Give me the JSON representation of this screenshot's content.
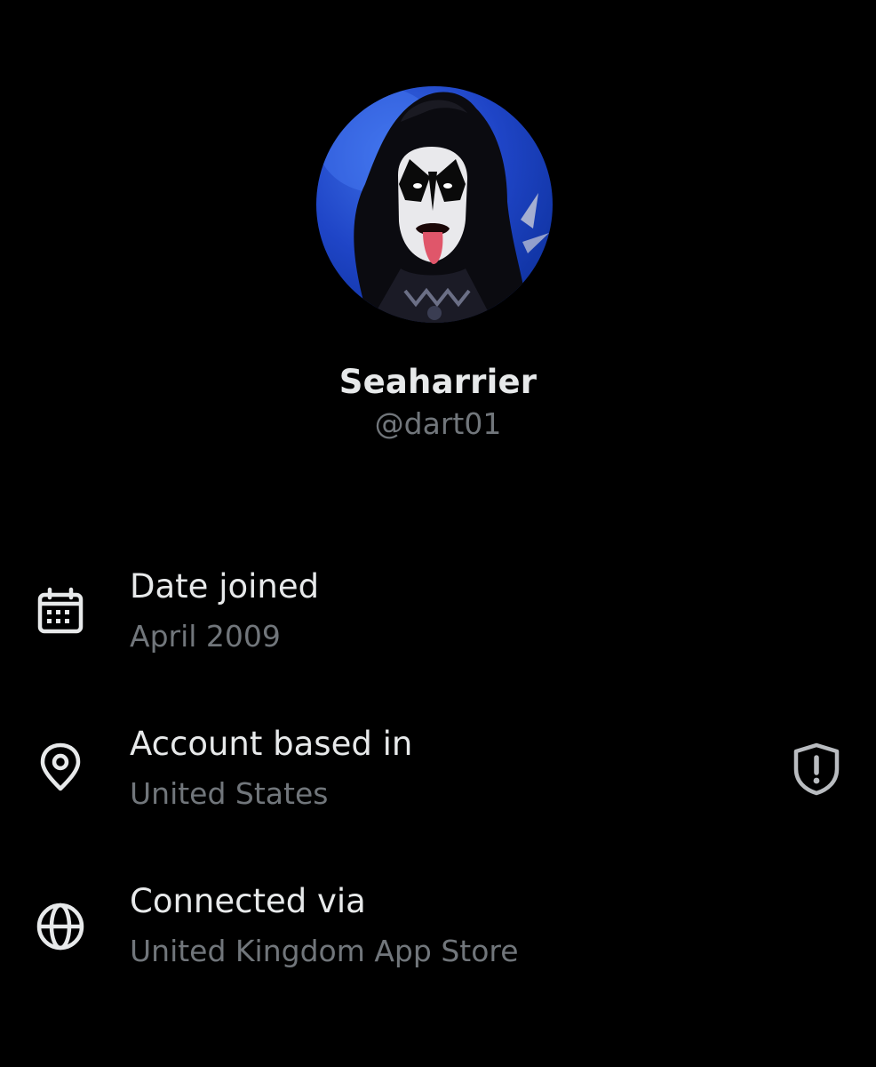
{
  "profile": {
    "display_name": "Seaharrier",
    "handle": "@dart01"
  },
  "about": {
    "items": [
      {
        "title": "Date joined",
        "value": "April 2009",
        "icon": "calendar-icon"
      },
      {
        "title": "Account based in",
        "value": "United States",
        "icon": "location-pin-icon",
        "badge_icon": "shield-alert-icon"
      },
      {
        "title": "Connected via",
        "value": "United Kingdom App Store",
        "icon": "globe-icon"
      }
    ]
  },
  "colors": {
    "background": "#000000",
    "primary_text": "#e7e9ea",
    "secondary_text": "#71767b",
    "avatar_background": "#1f45c7"
  }
}
